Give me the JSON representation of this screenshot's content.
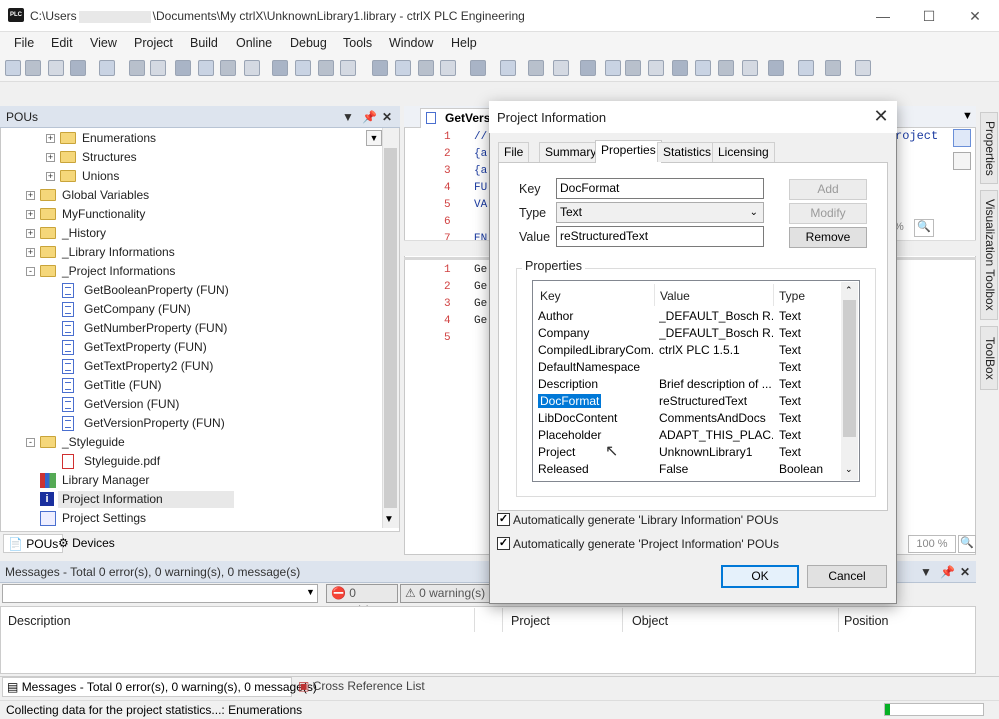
{
  "window": {
    "title_prefix": "C:\\Users",
    "title_suffix": "\\Documents\\My ctrlX\\UnknownLibrary1.library - ctrlX PLC Engineering",
    "logo_text": "PLC"
  },
  "menu": [
    "File",
    "Edit",
    "View",
    "Project",
    "Build",
    "Online",
    "Debug",
    "Tools",
    "Window",
    "Help"
  ],
  "pous_panel": {
    "title": "POUs",
    "tree": [
      {
        "label": "Enumerations",
        "icon": "folder-icon",
        "indent": 2,
        "expander": "+"
      },
      {
        "label": "Structures",
        "icon": "folder-icon",
        "indent": 2,
        "expander": "+"
      },
      {
        "label": "Unions",
        "icon": "folder-icon",
        "indent": 2,
        "expander": "+"
      },
      {
        "label": "Global Variables",
        "icon": "folder-icon",
        "indent": 1,
        "expander": "+"
      },
      {
        "label": "MyFunctionality",
        "icon": "folder-icon",
        "indent": 1,
        "expander": "+"
      },
      {
        "label": "_History",
        "icon": "folder-icon",
        "indent": 1,
        "expander": "+"
      },
      {
        "label": "_Library Informations",
        "icon": "folder-icon",
        "indent": 1,
        "expander": "+"
      },
      {
        "label": "_Project Informations",
        "icon": "folder-icon",
        "indent": 1,
        "expander": "-"
      },
      {
        "label": "GetBooleanProperty (FUN)",
        "icon": "pou-icon",
        "indent": 2
      },
      {
        "label": "GetCompany (FUN)",
        "icon": "pou-icon",
        "indent": 2
      },
      {
        "label": "GetNumberProperty (FUN)",
        "icon": "pou-icon",
        "indent": 2
      },
      {
        "label": "GetTextProperty (FUN)",
        "icon": "pou-icon",
        "indent": 2
      },
      {
        "label": "GetTextProperty2 (FUN)",
        "icon": "pou-icon",
        "indent": 2
      },
      {
        "label": "GetTitle (FUN)",
        "icon": "pou-icon",
        "indent": 2
      },
      {
        "label": "GetVersion (FUN)",
        "icon": "pou-icon",
        "indent": 2
      },
      {
        "label": "GetVersionProperty (FUN)",
        "icon": "pou-icon",
        "indent": 2
      },
      {
        "label": "_Styleguide",
        "icon": "folder-icon",
        "indent": 1,
        "expander": "-"
      },
      {
        "label": "Styleguide.pdf",
        "icon": "pdf-icon",
        "indent": 2
      },
      {
        "label": "Library Manager",
        "icon": "library-manager-icon",
        "indent": 1
      },
      {
        "label": "Project Information",
        "icon": "info-icon",
        "indent": 1,
        "selected": true
      },
      {
        "label": "Project Settings",
        "icon": "settings-icon",
        "indent": 1
      }
    ],
    "tabs": [
      "POUs",
      "Devices"
    ]
  },
  "editor": {
    "tab_label": "GetVers",
    "zoom_top": "%",
    "zoom_bottom": "100 %",
    "snippet_right": "roject",
    "top_lines": [
      {
        "num": "1",
        "code": "//"
      },
      {
        "num": "2",
        "code": "{a"
      },
      {
        "num": "3",
        "code": "{a"
      },
      {
        "num": "4",
        "code": "FU"
      },
      {
        "num": "5",
        "code": "VA"
      },
      {
        "num": "6",
        "code": ""
      },
      {
        "num": "7",
        "code": "EN"
      }
    ],
    "bottom_lines": [
      {
        "num": "1",
        "code": "Ge"
      },
      {
        "num": "2",
        "code": "Ge"
      },
      {
        "num": "3",
        "code": "Ge"
      },
      {
        "num": "4",
        "code": "Ge"
      },
      {
        "num": "5",
        "code": ""
      }
    ]
  },
  "right_strip": [
    "Properties",
    "Visualization Toolbox",
    "ToolBox"
  ],
  "messages": {
    "header": "Messages - Total 0 error(s), 0 warning(s), 0 message(s)",
    "errors": "0 error(s)",
    "warnings": "0 warning(s)",
    "columns": [
      "Description",
      "Project",
      "Object",
      "Position"
    ]
  },
  "bottom_tabs": [
    "Messages - Total 0 error(s), 0 warning(s), 0 message(s)",
    "Cross Reference List"
  ],
  "status": {
    "text": "Collecting data for the project statistics...: Enumerations",
    "progress": 0.05
  },
  "dialog": {
    "title": "Project Information",
    "tabs": [
      "File",
      "Summary",
      "Properties",
      "Statistics",
      "Licensing"
    ],
    "active_tab": "Properties",
    "key_label": "Key",
    "key_value": "DocFormat",
    "type_label": "Type",
    "type_value": "Text",
    "value_label": "Value",
    "value_value": "reStructuredText",
    "add_label": "Add",
    "modify_label": "Modify",
    "remove_label": "Remove",
    "properties_legend": "Properties",
    "columns": [
      "Key",
      "Value",
      "Type"
    ],
    "rows": [
      {
        "key": "Author",
        "value": "_DEFAULT_Bosch R...",
        "type": "Text"
      },
      {
        "key": "Company",
        "value": "_DEFAULT_Bosch R...",
        "type": "Text"
      },
      {
        "key": "CompiledLibraryCom...",
        "value": "ctrlX PLC 1.5.1",
        "type": "Text"
      },
      {
        "key": "DefaultNamespace",
        "value": "",
        "type": "Text"
      },
      {
        "key": "Description",
        "value": "Brief description of ...",
        "type": "Text"
      },
      {
        "key": "DocFormat",
        "value": "reStructuredText",
        "type": "Text",
        "selected": true
      },
      {
        "key": "LibDocContent",
        "value": "CommentsAndDocs",
        "type": "Text"
      },
      {
        "key": "Placeholder",
        "value": "ADAPT_THIS_PLAC...",
        "type": "Text"
      },
      {
        "key": "Project",
        "value": "UnknownLibrary1",
        "type": "Text"
      },
      {
        "key": "Released",
        "value": "False",
        "type": "Boolean"
      }
    ],
    "auto_lib_info": "Automatically generate 'Library Information' POUs",
    "auto_proj_info": "Automatically generate 'Project Information' POUs",
    "ok_label": "OK",
    "cancel_label": "Cancel"
  },
  "colors": {
    "accent": "#0078d7",
    "panel_header": "#dde4ee",
    "progress": "#06b025"
  }
}
